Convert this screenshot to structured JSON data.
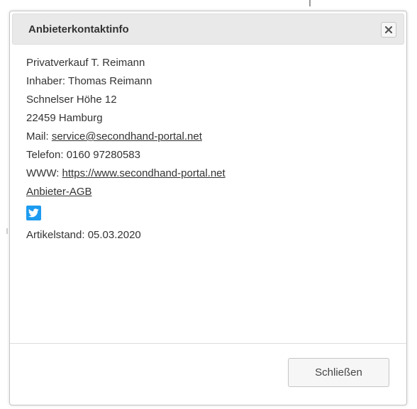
{
  "dialog": {
    "title": "Anbieterkontaktinfo",
    "close_icon": "close-icon",
    "lines": {
      "company": "Privatverkauf T. Reimann",
      "owner": "Inhaber: Thomas Reimann",
      "street": "Schnelser Höhe 12",
      "city": "22459 Hamburg",
      "mail_label": "Mail: ",
      "mail_link": "service@secondhand-portal.net",
      "phone": "Telefon: 0160 97280583",
      "www_label": "WWW: ",
      "www_link": "https://www.secondhand-portal.net",
      "agb_link": "Anbieter-AGB",
      "social_icon": "twitter-icon",
      "stand": "Artikelstand: 05.03.2020"
    },
    "close_button_label": "Schließen"
  },
  "colors": {
    "titlebar_bg": "#e9e9e9",
    "border": "#c5c5c5",
    "text": "#333333",
    "twitter_blue": "#1d9bf0"
  }
}
